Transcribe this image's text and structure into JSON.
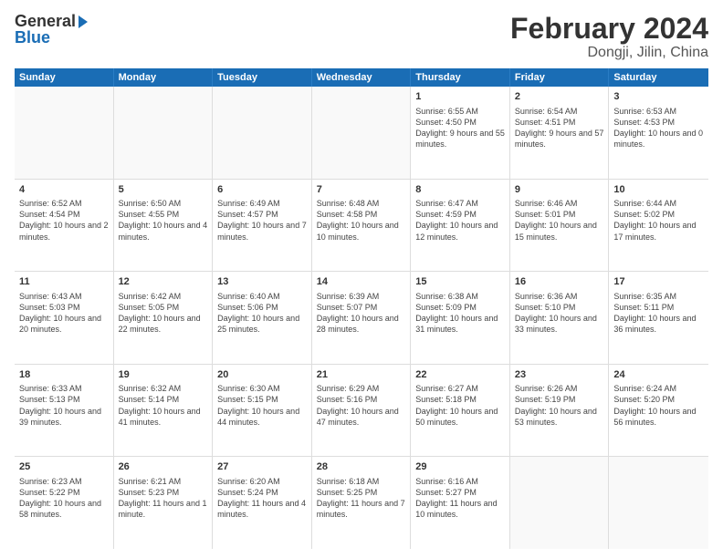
{
  "header": {
    "logo_general": "General",
    "logo_blue": "Blue",
    "title": "February 2024",
    "subtitle": "Dongji, Jilin, China"
  },
  "calendar": {
    "days": [
      "Sunday",
      "Monday",
      "Tuesday",
      "Wednesday",
      "Thursday",
      "Friday",
      "Saturday"
    ],
    "weeks": [
      [
        {
          "day": "",
          "info": ""
        },
        {
          "day": "",
          "info": ""
        },
        {
          "day": "",
          "info": ""
        },
        {
          "day": "",
          "info": ""
        },
        {
          "day": "1",
          "info": "Sunrise: 6:55 AM\nSunset: 4:50 PM\nDaylight: 9 hours and 55 minutes."
        },
        {
          "day": "2",
          "info": "Sunrise: 6:54 AM\nSunset: 4:51 PM\nDaylight: 9 hours and 57 minutes."
        },
        {
          "day": "3",
          "info": "Sunrise: 6:53 AM\nSunset: 4:53 PM\nDaylight: 10 hours and 0 minutes."
        }
      ],
      [
        {
          "day": "4",
          "info": "Sunrise: 6:52 AM\nSunset: 4:54 PM\nDaylight: 10 hours and 2 minutes."
        },
        {
          "day": "5",
          "info": "Sunrise: 6:50 AM\nSunset: 4:55 PM\nDaylight: 10 hours and 4 minutes."
        },
        {
          "day": "6",
          "info": "Sunrise: 6:49 AM\nSunset: 4:57 PM\nDaylight: 10 hours and 7 minutes."
        },
        {
          "day": "7",
          "info": "Sunrise: 6:48 AM\nSunset: 4:58 PM\nDaylight: 10 hours and 10 minutes."
        },
        {
          "day": "8",
          "info": "Sunrise: 6:47 AM\nSunset: 4:59 PM\nDaylight: 10 hours and 12 minutes."
        },
        {
          "day": "9",
          "info": "Sunrise: 6:46 AM\nSunset: 5:01 PM\nDaylight: 10 hours and 15 minutes."
        },
        {
          "day": "10",
          "info": "Sunrise: 6:44 AM\nSunset: 5:02 PM\nDaylight: 10 hours and 17 minutes."
        }
      ],
      [
        {
          "day": "11",
          "info": "Sunrise: 6:43 AM\nSunset: 5:03 PM\nDaylight: 10 hours and 20 minutes."
        },
        {
          "day": "12",
          "info": "Sunrise: 6:42 AM\nSunset: 5:05 PM\nDaylight: 10 hours and 22 minutes."
        },
        {
          "day": "13",
          "info": "Sunrise: 6:40 AM\nSunset: 5:06 PM\nDaylight: 10 hours and 25 minutes."
        },
        {
          "day": "14",
          "info": "Sunrise: 6:39 AM\nSunset: 5:07 PM\nDaylight: 10 hours and 28 minutes."
        },
        {
          "day": "15",
          "info": "Sunrise: 6:38 AM\nSunset: 5:09 PM\nDaylight: 10 hours and 31 minutes."
        },
        {
          "day": "16",
          "info": "Sunrise: 6:36 AM\nSunset: 5:10 PM\nDaylight: 10 hours and 33 minutes."
        },
        {
          "day": "17",
          "info": "Sunrise: 6:35 AM\nSunset: 5:11 PM\nDaylight: 10 hours and 36 minutes."
        }
      ],
      [
        {
          "day": "18",
          "info": "Sunrise: 6:33 AM\nSunset: 5:13 PM\nDaylight: 10 hours and 39 minutes."
        },
        {
          "day": "19",
          "info": "Sunrise: 6:32 AM\nSunset: 5:14 PM\nDaylight: 10 hours and 41 minutes."
        },
        {
          "day": "20",
          "info": "Sunrise: 6:30 AM\nSunset: 5:15 PM\nDaylight: 10 hours and 44 minutes."
        },
        {
          "day": "21",
          "info": "Sunrise: 6:29 AM\nSunset: 5:16 PM\nDaylight: 10 hours and 47 minutes."
        },
        {
          "day": "22",
          "info": "Sunrise: 6:27 AM\nSunset: 5:18 PM\nDaylight: 10 hours and 50 minutes."
        },
        {
          "day": "23",
          "info": "Sunrise: 6:26 AM\nSunset: 5:19 PM\nDaylight: 10 hours and 53 minutes."
        },
        {
          "day": "24",
          "info": "Sunrise: 6:24 AM\nSunset: 5:20 PM\nDaylight: 10 hours and 56 minutes."
        }
      ],
      [
        {
          "day": "25",
          "info": "Sunrise: 6:23 AM\nSunset: 5:22 PM\nDaylight: 10 hours and 58 minutes."
        },
        {
          "day": "26",
          "info": "Sunrise: 6:21 AM\nSunset: 5:23 PM\nDaylight: 11 hours and 1 minute."
        },
        {
          "day": "27",
          "info": "Sunrise: 6:20 AM\nSunset: 5:24 PM\nDaylight: 11 hours and 4 minutes."
        },
        {
          "day": "28",
          "info": "Sunrise: 6:18 AM\nSunset: 5:25 PM\nDaylight: 11 hours and 7 minutes."
        },
        {
          "day": "29",
          "info": "Sunrise: 6:16 AM\nSunset: 5:27 PM\nDaylight: 11 hours and 10 minutes."
        },
        {
          "day": "",
          "info": ""
        },
        {
          "day": "",
          "info": ""
        }
      ]
    ]
  }
}
